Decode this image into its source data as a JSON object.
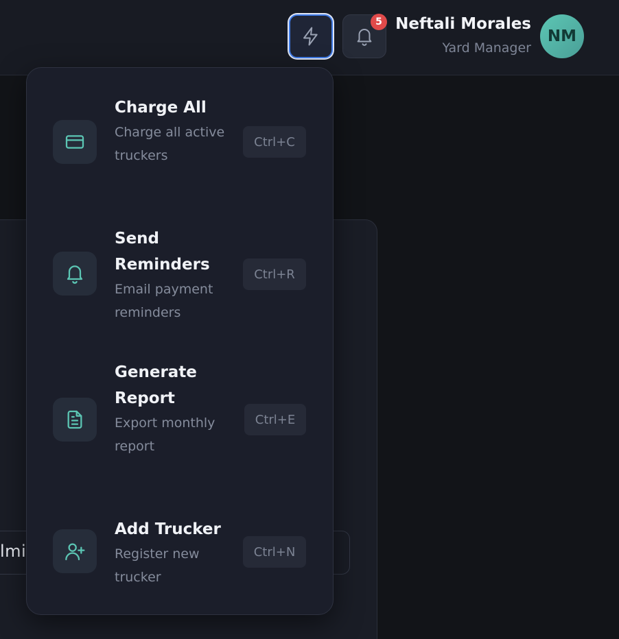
{
  "header": {
    "quick_actions_icon": "lightning-icon",
    "notifications_icon": "bell-icon",
    "notification_count": "5",
    "user": {
      "name": "Neftali Morales",
      "role": "Yard Manager",
      "initials": "NM"
    }
  },
  "background": {
    "partial_input_text": "lmi"
  },
  "colors": {
    "accent": "#5cc6b4",
    "badge": "#e04a4a",
    "focus_ring": "#3f7be8"
  },
  "quick_actions": [
    {
      "icon": "credit-card-icon",
      "title": "Charge All",
      "description": "Charge all active truckers",
      "shortcut": "Ctrl+C"
    },
    {
      "icon": "bell-icon",
      "title": "Send Reminders",
      "description": "Email payment reminders",
      "shortcut": "Ctrl+R"
    },
    {
      "icon": "document-icon",
      "title": "Generate Report",
      "description": "Export monthly report",
      "shortcut": "Ctrl+E"
    },
    {
      "icon": "user-plus-icon",
      "title": "Add Trucker",
      "description": "Register new trucker",
      "shortcut": "Ctrl+N"
    }
  ]
}
